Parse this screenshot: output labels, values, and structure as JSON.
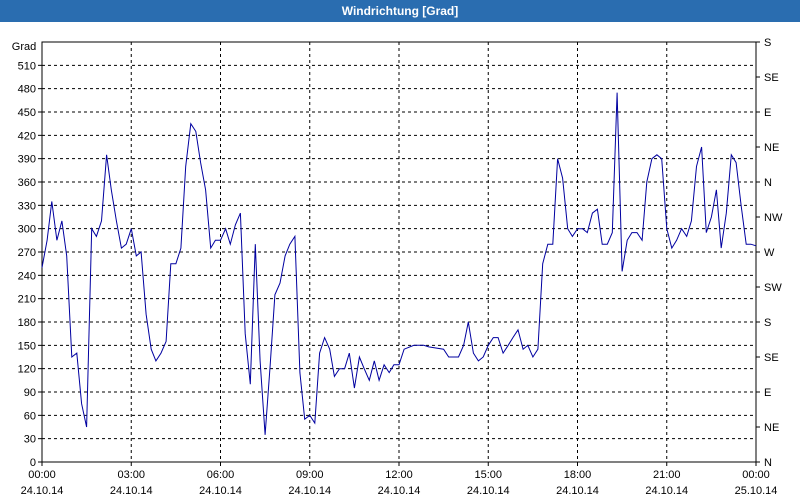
{
  "window": {
    "title": "Windrichtung [Grad]"
  },
  "chart_data": {
    "type": "line",
    "title": "Windrichtung [Grad]",
    "ylabel": "Grad",
    "ylim": [
      0,
      540
    ],
    "yticks": [
      0,
      30,
      60,
      90,
      120,
      150,
      180,
      210,
      240,
      270,
      300,
      330,
      360,
      390,
      420,
      450,
      480,
      510
    ],
    "right_ticks": [
      {
        "v": 0,
        "label": "N"
      },
      {
        "v": 45,
        "label": "NE"
      },
      {
        "v": 90,
        "label": "E"
      },
      {
        "v": 135,
        "label": "SE"
      },
      {
        "v": 180,
        "label": "S"
      },
      {
        "v": 225,
        "label": "SW"
      },
      {
        "v": 270,
        "label": "W"
      },
      {
        "v": 315,
        "label": "NW"
      },
      {
        "v": 360,
        "label": "N"
      },
      {
        "v": 405,
        "label": "NE"
      },
      {
        "v": 450,
        "label": "E"
      },
      {
        "v": 495,
        "label": "SE"
      },
      {
        "v": 540,
        "label": "S"
      }
    ],
    "xlim_hours": [
      0,
      24
    ],
    "xticks": [
      {
        "h": 0,
        "time": "00:00",
        "date": "24.10.14"
      },
      {
        "h": 3,
        "time": "03:00",
        "date": "24.10.14"
      },
      {
        "h": 6,
        "time": "06:00",
        "date": "24.10.14"
      },
      {
        "h": 9,
        "time": "09:00",
        "date": "24.10.14"
      },
      {
        "h": 12,
        "time": "12:00",
        "date": "24.10.14"
      },
      {
        "h": 15,
        "time": "15:00",
        "date": "24.10.14"
      },
      {
        "h": 18,
        "time": "18:00",
        "date": "24.10.14"
      },
      {
        "h": 21,
        "time": "21:00",
        "date": "24.10.14"
      },
      {
        "h": 24,
        "time": "00:00",
        "date": "25.10.14"
      }
    ],
    "grid": true,
    "series": [
      {
        "color": "#0000a0",
        "points": [
          [
            0,
            250
          ],
          [
            0.17,
            285
          ],
          [
            0.33,
            335
          ],
          [
            0.5,
            285
          ],
          [
            0.67,
            310
          ],
          [
            0.83,
            265
          ],
          [
            1,
            135
          ],
          [
            1.17,
            140
          ],
          [
            1.33,
            75
          ],
          [
            1.5,
            45
          ],
          [
            1.67,
            300
          ],
          [
            1.83,
            290
          ],
          [
            2,
            310
          ],
          [
            2.17,
            395
          ],
          [
            2.33,
            350
          ],
          [
            2.5,
            310
          ],
          [
            2.67,
            275
          ],
          [
            2.83,
            280
          ],
          [
            3,
            300
          ],
          [
            3.17,
            265
          ],
          [
            3.33,
            270
          ],
          [
            3.5,
            190
          ],
          [
            3.67,
            145
          ],
          [
            3.83,
            130
          ],
          [
            4,
            140
          ],
          [
            4.17,
            155
          ],
          [
            4.33,
            255
          ],
          [
            4.5,
            255
          ],
          [
            4.67,
            275
          ],
          [
            4.83,
            380
          ],
          [
            5,
            435
          ],
          [
            5.17,
            425
          ],
          [
            5.33,
            385
          ],
          [
            5.5,
            350
          ],
          [
            5.67,
            275
          ],
          [
            5.83,
            285
          ],
          [
            6,
            285
          ],
          [
            6.17,
            300
          ],
          [
            6.33,
            280
          ],
          [
            6.5,
            305
          ],
          [
            6.67,
            320
          ],
          [
            6.83,
            165
          ],
          [
            7,
            100
          ],
          [
            7.17,
            280
          ],
          [
            7.33,
            130
          ],
          [
            7.5,
            35
          ],
          [
            7.67,
            125
          ],
          [
            7.83,
            215
          ],
          [
            8,
            230
          ],
          [
            8.17,
            265
          ],
          [
            8.33,
            280
          ],
          [
            8.5,
            290
          ],
          [
            8.67,
            115
          ],
          [
            8.83,
            55
          ],
          [
            9,
            60
          ],
          [
            9.17,
            50
          ],
          [
            9.33,
            140
          ],
          [
            9.5,
            160
          ],
          [
            9.67,
            145
          ],
          [
            9.83,
            110
          ],
          [
            10,
            120
          ],
          [
            10.17,
            120
          ],
          [
            10.33,
            140
          ],
          [
            10.5,
            95
          ],
          [
            10.67,
            135
          ],
          [
            10.83,
            120
          ],
          [
            11,
            105
          ],
          [
            11.17,
            130
          ],
          [
            11.33,
            105
          ],
          [
            11.5,
            125
          ],
          [
            11.67,
            115
          ],
          [
            11.83,
            125
          ],
          [
            12,
            125
          ],
          [
            12.17,
            145
          ],
          [
            12.5,
            150
          ],
          [
            12.83,
            150
          ],
          [
            13,
            148
          ],
          [
            13.5,
            145
          ],
          [
            13.67,
            135
          ],
          [
            14,
            135
          ],
          [
            14.17,
            150
          ],
          [
            14.33,
            180
          ],
          [
            14.5,
            140
          ],
          [
            14.67,
            130
          ],
          [
            14.83,
            135
          ],
          [
            15,
            150
          ],
          [
            15.17,
            160
          ],
          [
            15.33,
            160
          ],
          [
            15.5,
            140
          ],
          [
            15.67,
            150
          ],
          [
            15.83,
            160
          ],
          [
            16,
            170
          ],
          [
            16.17,
            145
          ],
          [
            16.33,
            150
          ],
          [
            16.5,
            135
          ],
          [
            16.67,
            145
          ],
          [
            16.83,
            255
          ],
          [
            17,
            280
          ],
          [
            17.17,
            280
          ],
          [
            17.33,
            390
          ],
          [
            17.5,
            365
          ],
          [
            17.67,
            300
          ],
          [
            17.83,
            290
          ],
          [
            18,
            300
          ],
          [
            18.17,
            300
          ],
          [
            18.33,
            295
          ],
          [
            18.5,
            320
          ],
          [
            18.67,
            325
          ],
          [
            18.83,
            280
          ],
          [
            19,
            280
          ],
          [
            19.17,
            295
          ],
          [
            19.33,
            475
          ],
          [
            19.5,
            245
          ],
          [
            19.67,
            285
          ],
          [
            19.83,
            295
          ],
          [
            20,
            295
          ],
          [
            20.17,
            285
          ],
          [
            20.33,
            360
          ],
          [
            20.5,
            390
          ],
          [
            20.67,
            395
          ],
          [
            20.83,
            390
          ],
          [
            21,
            300
          ],
          [
            21.17,
            275
          ],
          [
            21.33,
            285
          ],
          [
            21.5,
            300
          ],
          [
            21.67,
            290
          ],
          [
            21.83,
            310
          ],
          [
            22,
            380
          ],
          [
            22.17,
            405
          ],
          [
            22.33,
            295
          ],
          [
            22.5,
            315
          ],
          [
            22.67,
            350
          ],
          [
            22.83,
            275
          ],
          [
            23,
            320
          ],
          [
            23.17,
            395
          ],
          [
            23.33,
            385
          ],
          [
            23.5,
            330
          ],
          [
            23.67,
            280
          ],
          [
            23.83,
            280
          ],
          [
            24,
            278
          ]
        ]
      }
    ]
  }
}
